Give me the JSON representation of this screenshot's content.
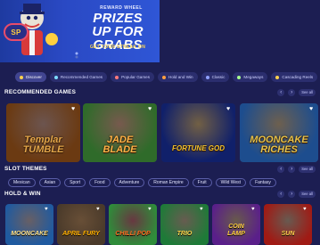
{
  "banner": {
    "logo": "SP",
    "kicker": "REWARD WHEEL",
    "headline_lines": [
      "PRIZES",
      "UP FOR",
      "GRABS"
    ],
    "sub": "GET YOUR STREAK ON"
  },
  "filters": [
    {
      "label": "Discover",
      "active": true,
      "color": "#ffd24d"
    },
    {
      "label": "Recommended Games",
      "active": false,
      "color": "#7ddcff"
    },
    {
      "label": "Popular Games",
      "active": false,
      "color": "#ff7a7a"
    },
    {
      "label": "Hold and Win",
      "active": false,
      "color": "#ff9f3f"
    },
    {
      "label": "Classic",
      "active": false,
      "color": "#8fa0ff"
    },
    {
      "label": "Megaways",
      "active": false,
      "color": "#a8ff8f"
    },
    {
      "label": "Cascading Reels",
      "active": false,
      "color": "#ffd24d"
    }
  ],
  "sections": {
    "recommended": {
      "title": "RECOMMENDED GAMES",
      "see_all": "See all"
    },
    "themes": {
      "title": "SLOT THEMES",
      "see_all": "See all"
    },
    "holdwin": {
      "title": "HOLD & WIN",
      "see_all": "See all"
    }
  },
  "recommended_games": [
    {
      "title_lines": [
        "Templar",
        "TUMBLE"
      ],
      "bg": "#6b3a12",
      "accent": "#e3a64a"
    },
    {
      "title_lines": [
        "JADE",
        "BLADE"
      ],
      "bg": "#2f6b2a",
      "accent": "#ffb347"
    },
    {
      "title_lines": [
        "FORTUNE GOD"
      ],
      "bg": "#10206a",
      "accent": "#f2c230"
    },
    {
      "title_lines": [
        "MOONCAKE",
        "RICHES"
      ],
      "bg": "#1d4d8e",
      "accent": "#e7c24a"
    }
  ],
  "themes": [
    "Mexican",
    "Asian",
    "Sport",
    "Food",
    "Adventure",
    "Roman Empire",
    "Fruit",
    "Wild West",
    "Fantasy"
  ],
  "holdwin_games": [
    {
      "title_lines": [
        "MOONCAKE"
      ],
      "bg": "#1f5aa0",
      "accent": "#ffe28a"
    },
    {
      "title_lines": [
        "APRIL FURY"
      ],
      "bg": "#4a3a2a",
      "accent": "#ffb000"
    },
    {
      "title_lines": [
        "CHILLI POP"
      ],
      "bg": "#2f8c3a",
      "accent": "#ff6b1f"
    },
    {
      "title_lines": [
        "TRIO"
      ],
      "bg": "#1e7a38",
      "accent": "#ffd84d"
    },
    {
      "title_lines": [
        "COIN",
        "LAMP"
      ],
      "bg": "#5a1f8a",
      "accent": "#ffcf3f"
    },
    {
      "title_lines": [
        "SUN"
      ],
      "bg": "#a01a14",
      "accent": "#ffd24d"
    }
  ],
  "icons": {
    "prev": "chevron-left-icon",
    "next": "chevron-right-icon",
    "favorite": "heart-icon"
  }
}
